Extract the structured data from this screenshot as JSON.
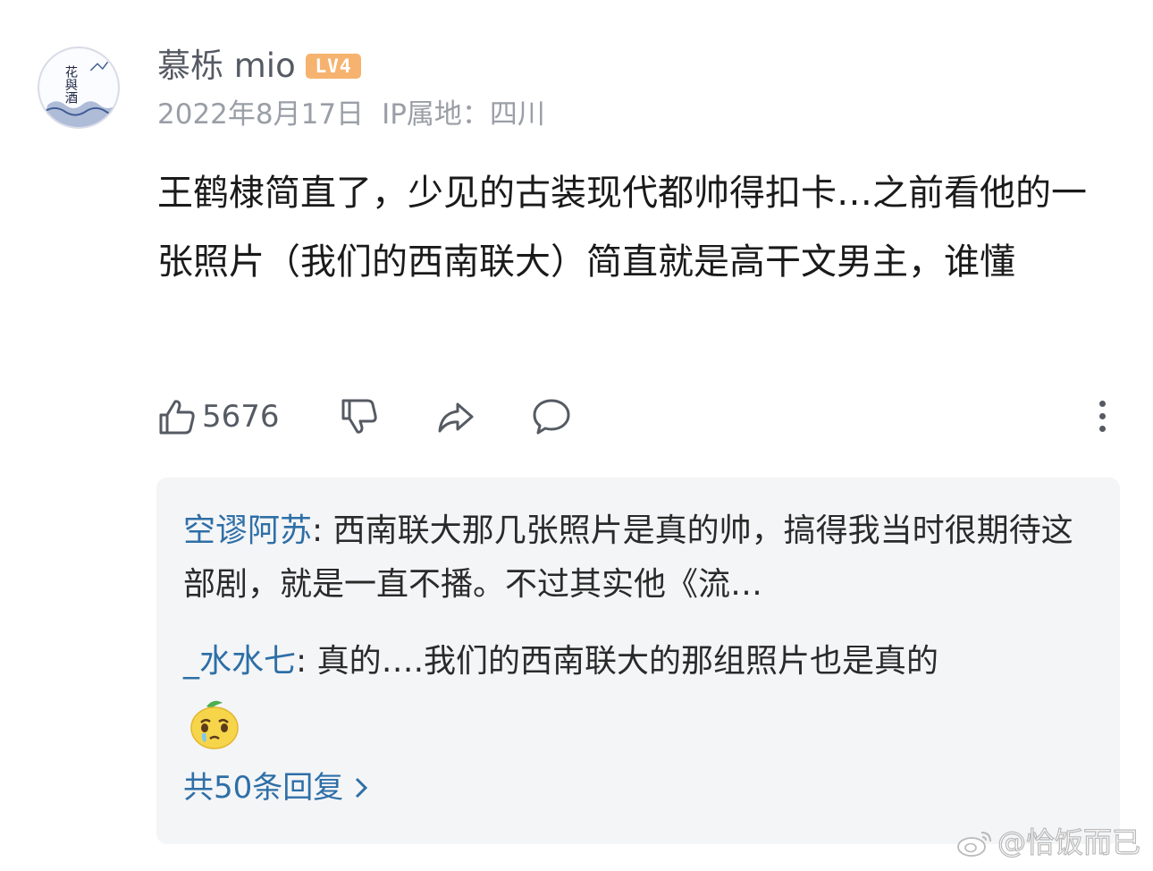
{
  "user": {
    "name": "慕栎 mio",
    "level": "LV4",
    "date": "2022年8月17日",
    "ip_location": "IP属地：四川",
    "avatar_text": "花與酒"
  },
  "comment": {
    "text": "王鹤棣简直了，少见的古装现代都帅得扣卡…之前看他的一张照片（我们的西南联大）简直就是高干文男主，谁懂"
  },
  "actions": {
    "like_count": "5676"
  },
  "replies": [
    {
      "author": "空谬阿苏",
      "separator": ": ",
      "text": "西南联大那几张照片是真的帅，搞得我当时很期待这部剧，就是一直不播。不过其实他《流…"
    },
    {
      "author": "_水水七",
      "separator": ": ",
      "text": "真的….我们的西南联大的那组照片也是真的"
    }
  ],
  "reply_summary": "共50条回复",
  "watermark": "@恰饭而已",
  "colors": {
    "link": "#2e6fa7",
    "level_badge": "#f6b36f",
    "reply_bg": "#f4f5f7"
  }
}
